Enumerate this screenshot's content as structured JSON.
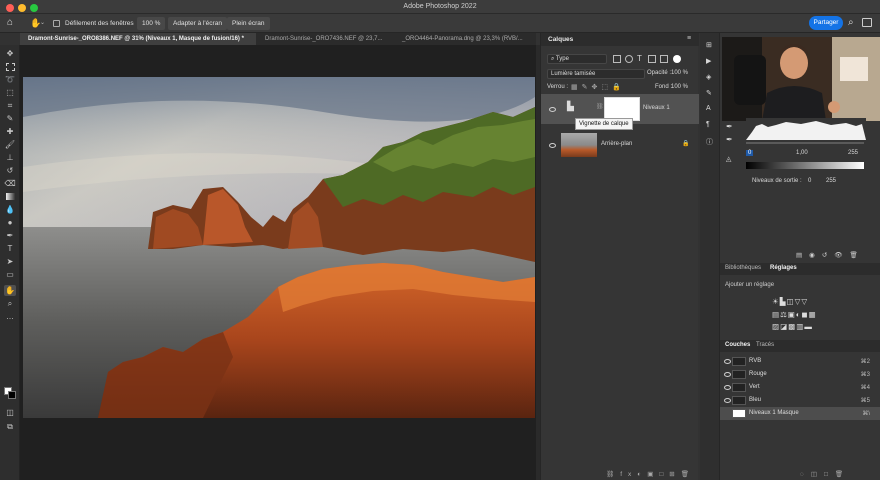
{
  "window": {
    "title": "Adobe Photoshop 2022"
  },
  "options_bar": {
    "scroll_all_windows": "Défilement des fenêtres",
    "zoom": "100 %",
    "fit_screen": "Adapter à l'écran",
    "full_screen": "Plein écran",
    "share": "Partager"
  },
  "tabs": [
    {
      "label": "Dramont-Sunrise-_ORO8386.NEF @ 31% (Niveaux 1, Masque de fusion/16) *"
    },
    {
      "label": "Dramont-Sunrise-_ORO7436.NEF @ 23,7..."
    },
    {
      "label": "_ORO4464-Panorama.dng @ 23,3% (RVB/..."
    }
  ],
  "layers_panel": {
    "title": "Calques",
    "filter_kind": "Type",
    "blend_mode": "Lumière tamisée",
    "opacity_label": "Opacité :",
    "opacity_value": "100 %",
    "lock_label": "Verrou :",
    "fill_label": "Fond :",
    "fill_value": "100 %",
    "layers": [
      {
        "name": "Niveaux 1"
      },
      {
        "name": "Arrière-plan"
      }
    ],
    "tooltip": "Vignette de calque"
  },
  "properties": {
    "input_levels": [
      "0",
      "1,00",
      "255"
    ],
    "output_label": "Niveaux de sortie :",
    "output_levels": [
      "0",
      "255"
    ]
  },
  "adjustments": {
    "tabs": [
      "Bibliothèques",
      "Réglages"
    ],
    "add_label": "Ajouter un réglage"
  },
  "channels": {
    "tabs": [
      "Couches",
      "Tracés"
    ],
    "rows": [
      {
        "name": "RVB",
        "shortcut": "⌘2"
      },
      {
        "name": "Rouge",
        "shortcut": "⌘3"
      },
      {
        "name": "Vert",
        "shortcut": "⌘4"
      },
      {
        "name": "Bleu",
        "shortcut": "⌘5"
      },
      {
        "name": "Niveaux 1 Masque",
        "shortcut": "⌘\\"
      }
    ]
  }
}
